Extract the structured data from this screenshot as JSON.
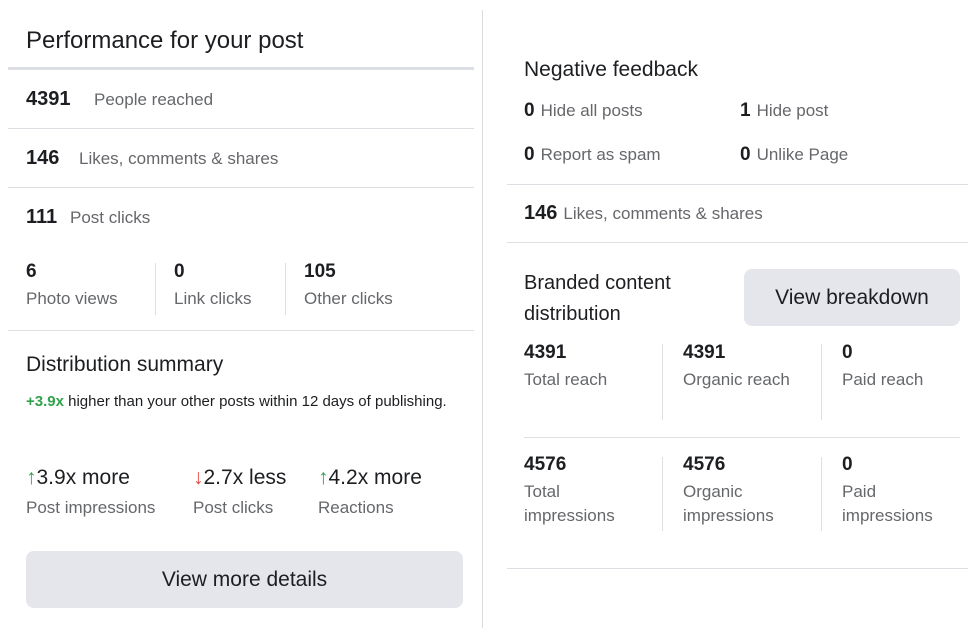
{
  "performance": {
    "title": "Performance for your post",
    "people_reached": {
      "value": "4391",
      "label": "People reached"
    },
    "engagement": {
      "value": "146",
      "label": "Likes, comments & shares"
    },
    "post_clicks": {
      "value": "111",
      "label": "Post clicks"
    },
    "clicks_breakdown": [
      {
        "value": "6",
        "label": "Photo views"
      },
      {
        "value": "0",
        "label": "Link clicks"
      },
      {
        "value": "105",
        "label": "Other clicks"
      }
    ]
  },
  "distribution": {
    "title": "Distribution summary",
    "highlight": "+3.9x",
    "description": " higher than your other posts within 12 days of publishing.",
    "metrics": [
      {
        "arrow": "↑",
        "direction": "up",
        "value": "3.9x more",
        "label": "Post impressions"
      },
      {
        "arrow": "↓",
        "direction": "down",
        "value": "2.7x less",
        "label": "Post clicks"
      },
      {
        "arrow": "↑",
        "direction": "up",
        "value": "4.2x more",
        "label": "Reactions"
      }
    ],
    "button_label": "View more details"
  },
  "negative_feedback": {
    "title": "Negative feedback",
    "items": [
      {
        "value": "0",
        "label": "Hide all posts"
      },
      {
        "value": "1",
        "label": "Hide post"
      },
      {
        "value": "0",
        "label": "Report as spam"
      },
      {
        "value": "0",
        "label": "Unlike Page"
      }
    ]
  },
  "engagement_right": {
    "value": "146",
    "label": "Likes, comments & shares"
  },
  "branded": {
    "title": "Branded content distribution",
    "button_label": "View breakdown",
    "reach": [
      {
        "value": "4391",
        "label": "Total reach"
      },
      {
        "value": "4391",
        "label": "Organic reach"
      },
      {
        "value": "0",
        "label": "Paid reach"
      }
    ],
    "impressions": [
      {
        "value": "4576",
        "label": "Total impressions"
      },
      {
        "value": "4576",
        "label": "Organic impressions"
      },
      {
        "value": "0",
        "label": "Paid impressions"
      }
    ]
  },
  "colors": {
    "positive": "#31a24c",
    "negative": "#e4463b",
    "button_bg": "#e4e6eb"
  }
}
